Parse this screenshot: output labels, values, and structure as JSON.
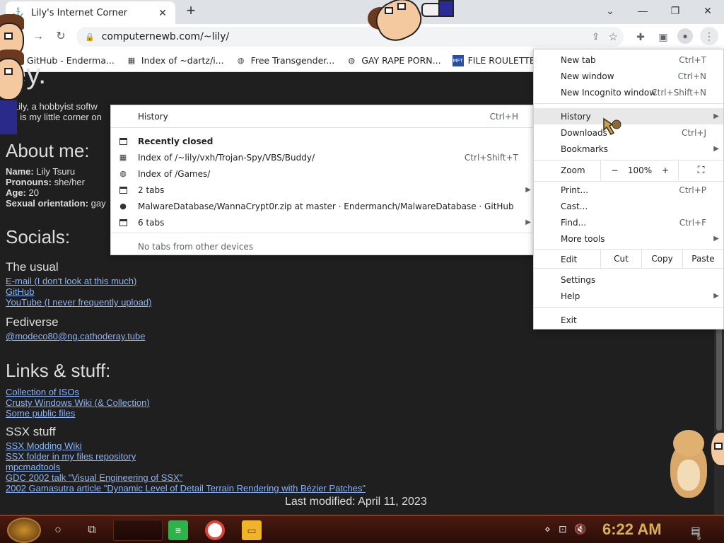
{
  "browser": {
    "tab_title": "Lily's Internet Corner",
    "url": "computernewb.com/~lily/",
    "bookmarks": [
      {
        "label": "GitHub - Enderma...",
        "icon": "github-icon"
      },
      {
        "label": "Index of ~dartz/i...",
        "icon": "file-index-icon"
      },
      {
        "label": "Free Transgender...",
        "icon": "globe-icon"
      },
      {
        "label": "GAY RAPE PORN...",
        "icon": "globe-icon"
      },
      {
        "label": "FILE ROULETTE",
        "icon": "roulette-icon"
      }
    ]
  },
  "page": {
    "title_fragment": "ley.",
    "intro_line1": "n Lily, a hobbyist softw",
    "intro_line2": "his is my little corner on",
    "about_heading": "About me:",
    "about": {
      "name_label": "Name:",
      "name_value": "Lily Tsuru",
      "pronouns_label": "Pronouns:",
      "pronouns_value": "she/her",
      "age_label": "Age:",
      "age_value": "20",
      "orientation_label": "Sexual orientation:",
      "orientation_value": "gay"
    },
    "socials_heading": "Socials:",
    "usual_heading": "The usual",
    "usual_links": [
      "E-mail (I don't look at this much)",
      "GitHub",
      "YouTube (I never frequently upload)"
    ],
    "fediverse_heading": "Fediverse",
    "fediverse_links": [
      "@modeco80@ng.cathoderay.tube"
    ],
    "links_heading": "Links & stuff:",
    "links": [
      "Collection of ISOs",
      "Crusty Windows Wiki (& Collection)",
      "Some public files"
    ],
    "ssx_heading": "SSX stuff",
    "ssx_links": [
      "SSX Modding Wiki",
      "SSX folder in my files repository",
      "mpcmadtools",
      "GDC 2002 talk \"Visual Engineering of SSX\"",
      "2002 Gamasutra article \"Dynamic Level of Detail Terrain Rendering with Bézier Patches\""
    ],
    "last_modified": "Last modified: April 11, 2023"
  },
  "chrome_menu": {
    "new_tab": "New tab",
    "new_tab_sc": "Ctrl+T",
    "new_window": "New window",
    "new_window_sc": "Ctrl+N",
    "incognito": "New Incognito window",
    "incognito_sc": "Ctrl+Shift+N",
    "history": "History",
    "downloads": "Downloads",
    "downloads_sc": "Ctrl+J",
    "bookmarks": "Bookmarks",
    "zoom": "Zoom",
    "zoom_minus": "−",
    "zoom_value": "100%",
    "zoom_plus": "+",
    "print": "Print...",
    "print_sc": "Ctrl+P",
    "cast": "Cast...",
    "find": "Find...",
    "find_sc": "Ctrl+F",
    "more_tools": "More tools",
    "edit": "Edit",
    "cut": "Cut",
    "copy": "Copy",
    "paste": "Paste",
    "settings": "Settings",
    "help": "Help",
    "exit": "Exit"
  },
  "history_menu": {
    "history": "History",
    "history_sc": "Ctrl+H",
    "recently_closed": "Recently closed",
    "items": [
      {
        "label": "Index of /~lily/vxh/Trojan-Spy/VBS/Buddy/",
        "sc": "Ctrl+Shift+T",
        "icon": "file-index-icon"
      },
      {
        "label": "Index of /Games/",
        "sc": "",
        "icon": "globe-icon"
      },
      {
        "label": "2 tabs",
        "sc": "",
        "icon": "window-icon"
      },
      {
        "label": "MalwareDatabase/WannaCrypt0r.zip at master · Endermanch/MalwareDatabase · GitHub",
        "sc": "",
        "icon": "github-icon"
      },
      {
        "label": "6 tabs",
        "sc": "",
        "icon": "window-icon"
      }
    ],
    "no_tabs": "No tabs from other devices"
  },
  "taskbar": {
    "clock": "6:22 AM",
    "notification_count": "5"
  }
}
